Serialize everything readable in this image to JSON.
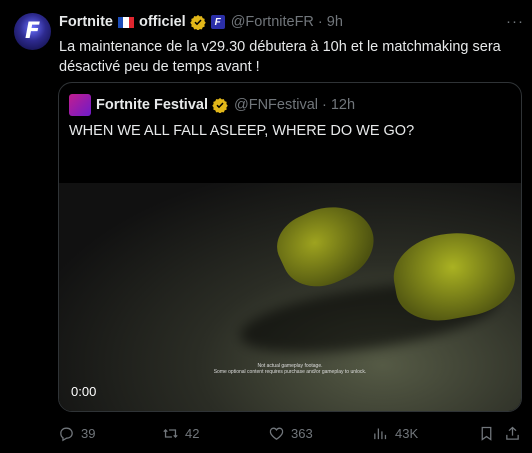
{
  "post": {
    "display_name": "Fortnite",
    "display_name_2": "officiel",
    "handle": "@FortniteFR",
    "dot": "·",
    "time": "9h",
    "text": "La maintenance de la v29.30 débutera à 10h et le matchmaking sera désactivé peu de temps avant !",
    "more": "···"
  },
  "quote": {
    "display_name": "Fortnite Festival",
    "handle": "@FNFestival",
    "dot": "·",
    "time": "12h",
    "text": "WHEN WE ALL FALL ASLEEP, WHERE DO WE GO?",
    "video": {
      "caption_line1": "Not actual gameplay footage.",
      "caption_line2": "Some optional content requires purchase and/or gameplay to unlock.",
      "time": "0:00"
    }
  },
  "actions": {
    "replies": "39",
    "reposts": "42",
    "likes": "363",
    "views": "43K"
  },
  "colors": {
    "background": "#000000",
    "text": "#e7e9ea",
    "muted": "#71767b",
    "verified_gold": "#e2b719"
  },
  "icons": [
    "verified-gold-icon",
    "affiliate-badge-icon",
    "reply-icon",
    "repost-icon",
    "like-icon",
    "views-icon",
    "bookmark-icon",
    "share-icon",
    "more-icon"
  ]
}
